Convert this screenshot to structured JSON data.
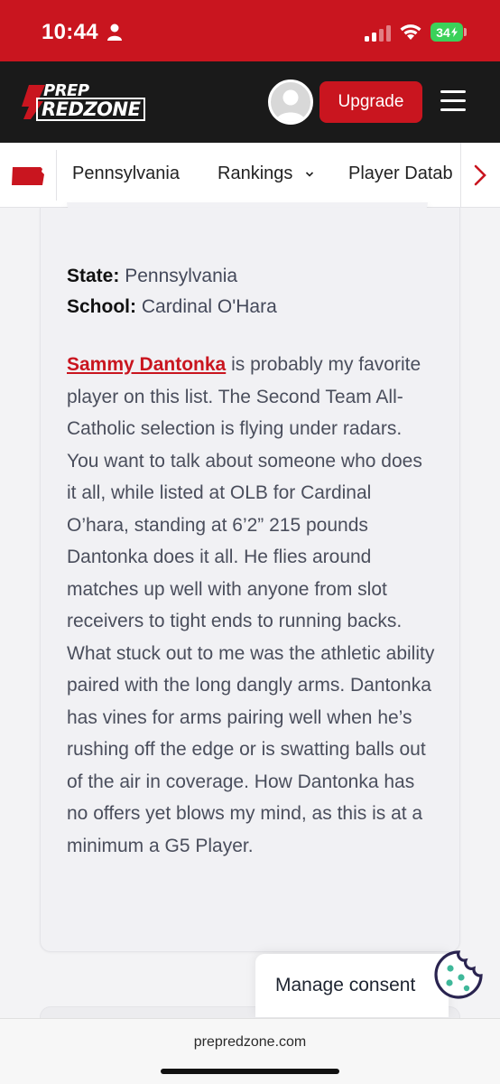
{
  "status_bar": {
    "time": "10:44",
    "battery": "34",
    "colors": {
      "bar": "#c9151f",
      "battery": "#3bd15a"
    },
    "icons": [
      "person-icon",
      "signal-icon",
      "wifi-icon",
      "battery-icon"
    ]
  },
  "header": {
    "logo_top": "PREP",
    "logo_bottom": "REDZONE",
    "upgrade_label": "Upgrade",
    "icons": [
      "avatar",
      "hamburger-menu-icon"
    ],
    "colors": {
      "background": "#1a1a1a",
      "accent": "#c9151f"
    }
  },
  "sub_nav": {
    "items": [
      {
        "label": "Pennsylvania"
      },
      {
        "label": "Rankings"
      },
      {
        "label": "Player Datab"
      }
    ],
    "icons": [
      "pennsylvania-flag-icon",
      "chevron-down-icon",
      "chevron-right-icon"
    ]
  },
  "article": {
    "state_label": "State:",
    "state_value": "Pennsylvania",
    "school_label": "School:",
    "school_value": "Cardinal O'Hara",
    "player_name": "Sammy Dantonka",
    "body": " is probably my favorite player on this list. The Second Team All-Catholic selection is flying under radars. You want to talk about someone who does it all, while listed at OLB for Cardinal O’hara, standing at 6’2” 215 pounds Dantonka does it all. He flies around matches up well with anyone from slot receivers to tight ends to running backs. What stuck out to me was the athletic ability paired with the long dangly arms. Dantonka has vines for arms pairing well when he’s rushing off the edge or is swatting balls out of the air in coverage. How Dantonka has no offers yet blows my mind, as this is at a minimum a G5 Player."
  },
  "consent": {
    "label": "Manage consent",
    "icon": "cookie-icon",
    "icon_color": "#3fb89a"
  },
  "browser": {
    "url": "prepredzone.com"
  }
}
